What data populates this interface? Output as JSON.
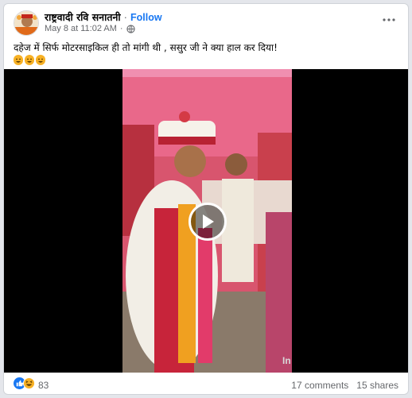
{
  "post": {
    "author_name": "राष्ट्रवादी रवि सनातनी",
    "separator": "·",
    "follow_label": "Follow",
    "timestamp": "May 8 at 11:02 AM",
    "meta_separator": "·",
    "caption": "दहेज में सिर्फ मोटरसाइकिल ही तो मांगी थी , ससुर जी ने क्या हाल कर दिया!",
    "caption_emojis": [
      "grinning-face",
      "grinning-face",
      "grinning-face"
    ]
  },
  "video": {
    "watermark": "In"
  },
  "footer": {
    "reaction_icons": [
      "like-icon",
      "haha-icon"
    ],
    "reaction_count": "83",
    "comments": "17 comments",
    "shares": "15 shares"
  },
  "colors": {
    "accent": "#1877f2",
    "muted_text": "#65676b",
    "like_blue": "#1877f2",
    "haha_yellow": "#f7b125"
  }
}
